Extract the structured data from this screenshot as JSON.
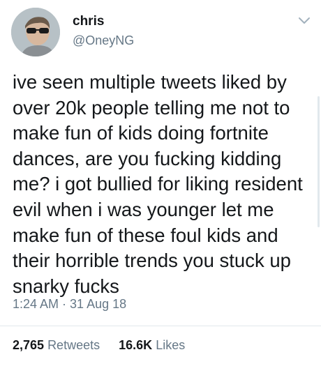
{
  "tweet": {
    "author": {
      "name": "chris",
      "handle": "@OneyNG"
    },
    "text_lines": [
      "ive seen multiple tweets liked by",
      "over 20k people telling me not to",
      "make fun of kids doing fortnite",
      "dances, are you fucking kidding",
      "me? i got bullied for liking resident",
      "evil when i was younger let me",
      "make fun of these foul kids and",
      "their horrible trends you stuck up",
      "snarky fucks"
    ],
    "timestamp": "1:24 AM · 31 Aug 18",
    "stats": {
      "retweets_count": "2,765",
      "retweets_label": "Retweets",
      "likes_count": "16.6K",
      "likes_label": "Likes"
    }
  },
  "icons": {
    "menu": "chevron-down-icon",
    "avatar": "avatar"
  },
  "colors": {
    "text": "#14171a",
    "secondary": "#657786",
    "divider": "#e1e8ed",
    "background": "#ffffff"
  }
}
